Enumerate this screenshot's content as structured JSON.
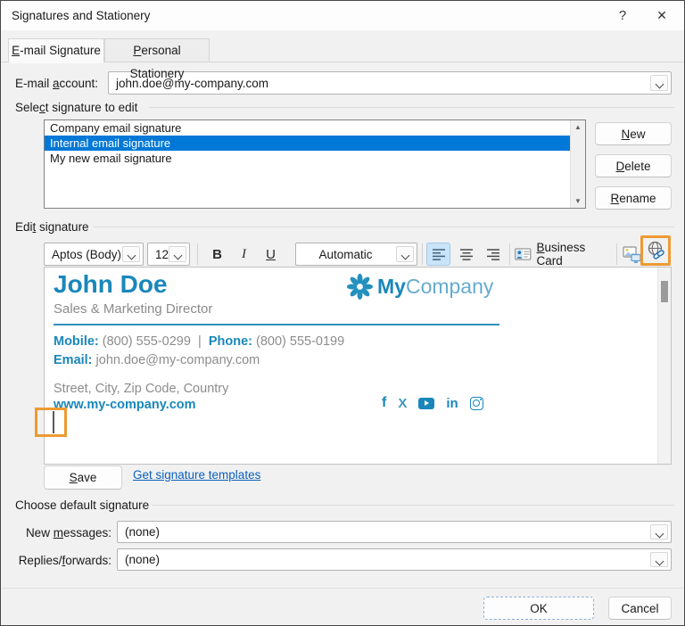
{
  "dialog": {
    "title": "Signatures and Stationery",
    "help_label": "?",
    "close_label": "✕"
  },
  "tabs": {
    "email_signature": {
      "pre": "",
      "key": "E",
      "post": "-mail Signature"
    },
    "personal_stationery": {
      "pre": "",
      "key": "P",
      "post": "ersonal Stationery"
    }
  },
  "account": {
    "label": {
      "pre": "E-mail ",
      "key": "a",
      "post": "ccount:"
    },
    "value": "john.doe@my-company.com"
  },
  "signature_list": {
    "group_label": {
      "pre": "Sele",
      "key": "c",
      "post": "t signature to edit"
    },
    "items": [
      "Company email signature",
      "Internal email signature",
      "My new email signature"
    ],
    "selected_index": 1,
    "scroll_up": "▲",
    "scroll_down": "▼",
    "new_button": {
      "pre": "",
      "key": "N",
      "post": "ew"
    },
    "delete_button": {
      "pre": "",
      "key": "D",
      "post": "elete"
    },
    "rename_button": {
      "pre": "",
      "key": "R",
      "post": "ename"
    }
  },
  "edit_signature": {
    "group_label": {
      "pre": "Edi",
      "key": "t",
      "post": " signature"
    },
    "toolbar": {
      "font_name": "Aptos (Body)",
      "font_size": "12",
      "bold": "B",
      "italic": "I",
      "underline": "U",
      "font_color": "Automatic",
      "business_card": {
        "pre": "",
        "key": "B",
        "post": "usiness Card"
      }
    },
    "preview": {
      "name": "John Doe",
      "job_title": "Sales & Marketing Director",
      "logo_bold": "My",
      "logo_light": "Company",
      "mobile_label": "Mobile:",
      "mobile_value": "(800) 555-0299",
      "divider": "|",
      "phone_label": "Phone:",
      "phone_value": "(800) 555-0199",
      "email_label": "Email:",
      "email_value": "john.doe@my-company.com",
      "address": "Street, City, Zip Code, Country",
      "website": "www.my-company.com",
      "social": {
        "facebook": "f",
        "x": "X",
        "linkedin": "in"
      }
    },
    "save_button": {
      "pre": "",
      "key": "S",
      "post": "ave"
    },
    "templates_link": "Get signature templates"
  },
  "defaults": {
    "group_label": "Choose default signature",
    "new_messages": {
      "label": {
        "pre": "New ",
        "key": "m",
        "post": "essages:"
      },
      "value": "(none)"
    },
    "replies_forwards": {
      "label": {
        "pre": "Replies/",
        "key": "f",
        "post": "orwards:"
      },
      "value": "(none)"
    }
  },
  "footer": {
    "ok_label": "OK",
    "cancel_label": "Cancel"
  },
  "colors": {
    "brand_blue": "#1987ba",
    "brand_blue_light": "#66abce",
    "selection_blue": "#0078d7",
    "highlight_orange": "#ed9a33",
    "gray_text": "#8c8c8c",
    "link_blue": "#0b5fbd"
  }
}
